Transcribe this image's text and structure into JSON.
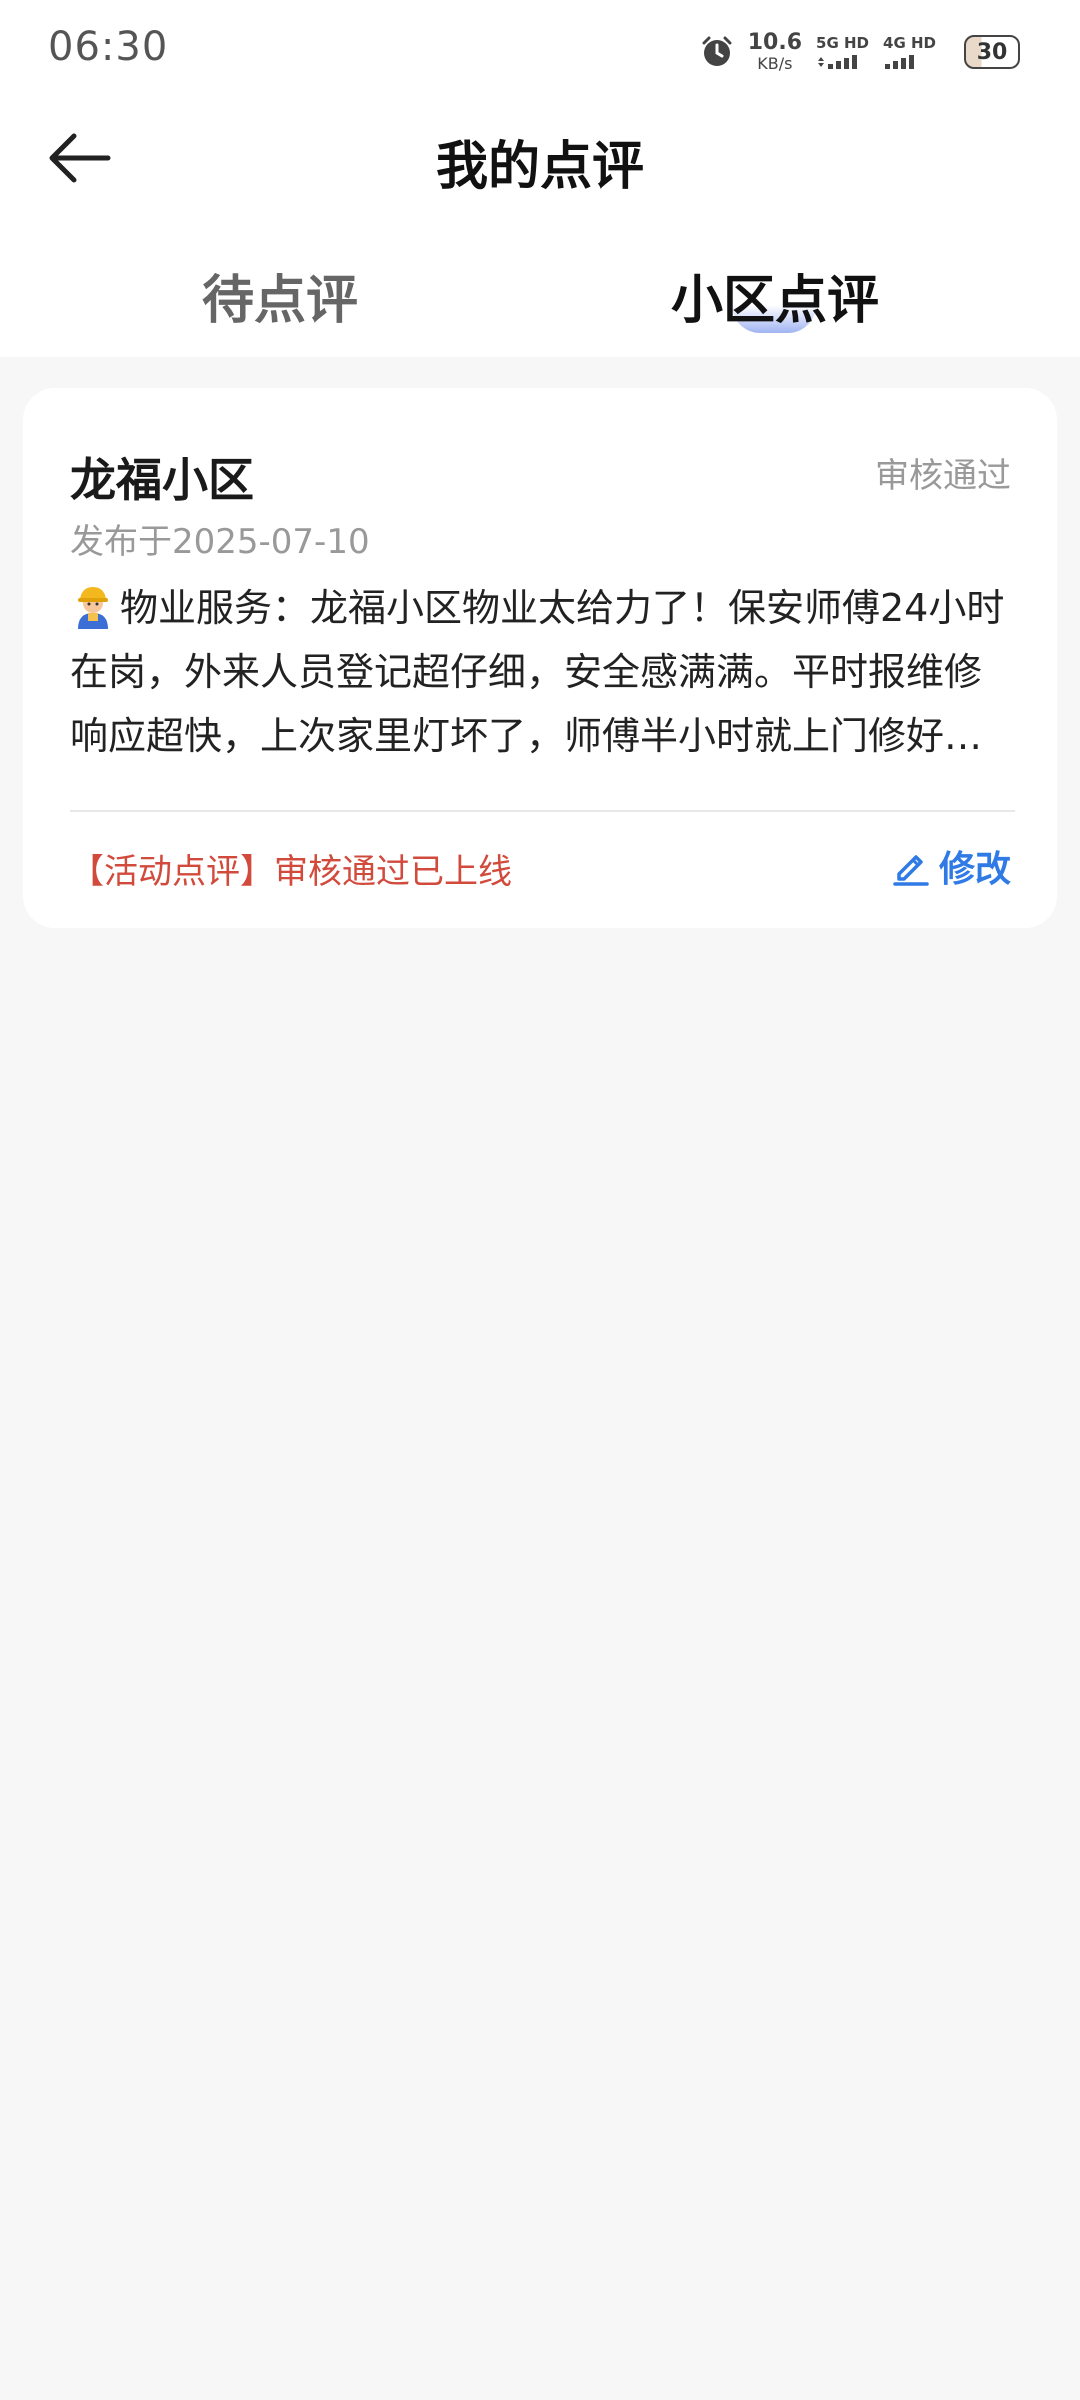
{
  "status_bar": {
    "time": "06:30",
    "net_speed_value": "10.6",
    "net_speed_unit": "KB/s",
    "signal_1_label": "5G HD",
    "signal_2_label": "4G HD",
    "battery_level": "30"
  },
  "header": {
    "title": "我的点评"
  },
  "tabs": {
    "pending": "待点评",
    "community": "小区点评",
    "active": "community"
  },
  "review_card": {
    "community_name": "龙福小区",
    "status": "审核通过",
    "publish_date": "发布于2025-07-10",
    "content_icon": "worker-icon",
    "content": "物业服务：龙福小区物业太给力了！保安师傅24小时在岗，外来人员登记超仔细，安全感满满。平时报维修响应超快，上次家里灯坏了，师傅半小时就上门修好了。",
    "activity_note": "【活动点评】审核通过已上线",
    "edit_label": "修改"
  },
  "colors": {
    "background": "#f7f7f7",
    "accent_blue": "#2f7ae5",
    "activity_red": "#d24a3c"
  }
}
